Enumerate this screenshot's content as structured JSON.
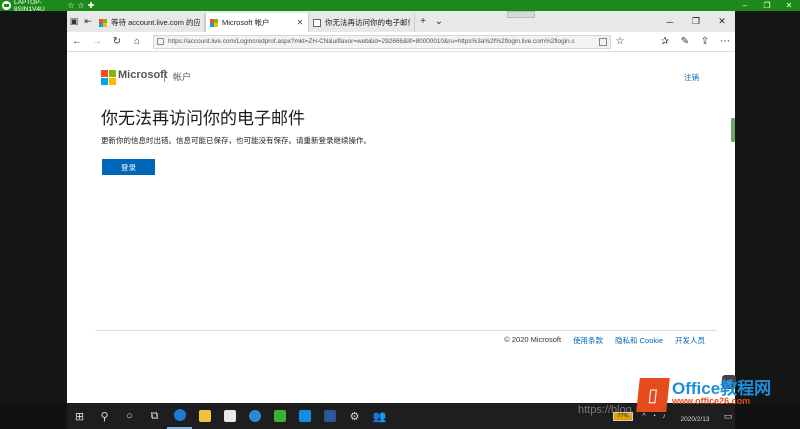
{
  "rdp_bar": {
    "host": "LAPTOP-8SIN1V4U"
  },
  "tabs": [
    {
      "label": "等待 account.live.com 的应",
      "active": false
    },
    {
      "label": "Microsoft 帐户",
      "active": true
    },
    {
      "label": "你无法再访问你的电子邮件",
      "active": false
    }
  ],
  "address_bar": {
    "url": "https://account.live.com/Logincredprof.aspx?mkt=ZH-CN&uiflavor=web&id=292666&lif=80000010&ru=https%3a%2f%2flogin.live.com%2flogin.s"
  },
  "header": {
    "brand": "Microsoft",
    "section": "帐户",
    "sign_out": "注销"
  },
  "main": {
    "heading": "你无法再访问你的电子邮件",
    "description": "更新你的信息时出错。信息可能已保存，也可能没有保存。请重新登录继续操作。",
    "sign_in_button": "登录"
  },
  "footer": {
    "copyright": "© 2020 Microsoft",
    "terms": "使用条款",
    "privacy": "隐私和 Cookie",
    "developers": "开发人员"
  },
  "taskbar": {
    "battery": "77%",
    "time": "",
    "date": "2020/2/13"
  },
  "watermark": {
    "url": "https://blog",
    "site_name": "Office教程网",
    "site_url": "www.office26.com"
  },
  "colors": {
    "accent": "#0067b8",
    "rdp_green": "#1b8a1b",
    "watermark_orange": "#e64b1e"
  }
}
